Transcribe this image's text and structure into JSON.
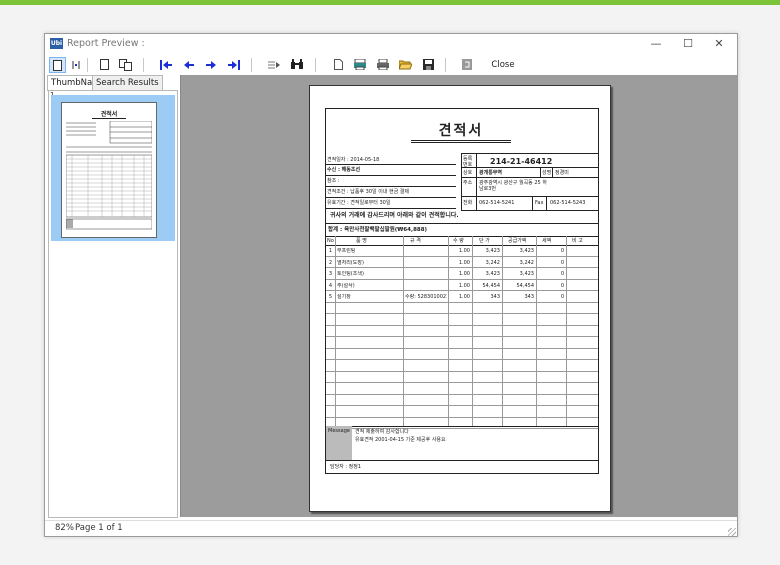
{
  "window": {
    "title": "Report Preview :",
    "app_icon_text": "Ubi",
    "minimize": "—",
    "maximize": "☐",
    "close": "✕"
  },
  "toolbar": {
    "close_label": "Close"
  },
  "tabs": [
    {
      "label": "ThumbNails"
    },
    {
      "label": "Search Results"
    }
  ],
  "thumbnails": [
    {
      "number": "1"
    }
  ],
  "status": {
    "zoom": "82%",
    "page_info": "Page 1 of 1"
  },
  "document": {
    "title": "견적서",
    "date_label": "견적일자 : 2014-05-18",
    "recipient": "수신 : 해동조선",
    "reference": "참조 :",
    "validity": "견적조건 : 납품후 30일 이내 현금 결제",
    "delivery": "유효기간 : 견적일로부터 30일",
    "reg_label": "등록번호",
    "reg_number": "214-21-46412",
    "company_label": "상호",
    "company_name": "광개통무역",
    "ceo_label": "성명",
    "ceo_name": "정경미",
    "address_label": "주소",
    "address": "광주광역시 광산구 월곡동 25 하남로3번",
    "phone_label": "전화",
    "phone": "062-514-5241",
    "fax_label": "Fax",
    "fax": "062-514-5243",
    "greeting": "귀사의 거래에 감사드리며 아래와 같이 견적합니다.",
    "total": "합계 : 육만사천팔백팔십팔원(₩64,888)",
    "columns": [
      "No",
      "품 명",
      "규 격",
      "수 량",
      "단 가",
      "공급가액",
      "세액",
      "비 고"
    ],
    "rows": [
      [
        "1",
        "무프린팅",
        "",
        "1.00",
        "3,423",
        "3,423",
        "0",
        ""
      ],
      [
        "2",
        "열처리(도장)",
        "",
        "1.00",
        "3,242",
        "3,242",
        "0",
        ""
      ],
      [
        "3",
        "토인팅(조색)",
        "",
        "1.00",
        "3,423",
        "3,423",
        "0",
        ""
      ],
      [
        "4",
        "주(절삭)",
        "",
        "1.00",
        "54,454",
        "54,454",
        "0",
        ""
      ],
      [
        "5",
        "절기창",
        "수량: 5283010021",
        "1.00",
        "343",
        "343",
        "0",
        ""
      ]
    ],
    "message_label": "Message",
    "message_lines": [
      "견적 제출하여 감사합니다",
      "유효견적 2001-04-15 기준 제공후 사용요"
    ],
    "manager": "담당자 : 정정1"
  },
  "thumbnail_doc": {
    "title": "견적서"
  }
}
